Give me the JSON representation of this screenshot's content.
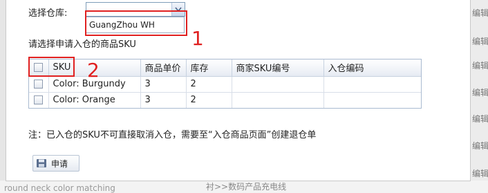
{
  "background": {
    "right_edit_labels": [
      "编辑",
      "编辑",
      "编辑",
      "编辑",
      "编辑",
      "编辑",
      "编辑"
    ],
    "bottom_left_text": "round neck color matching",
    "bottom_mid_text": "衬>>数码产品充电线"
  },
  "warehouse": {
    "label": "选择仓库:",
    "selected_value": "",
    "options": [
      "GuangZhou WH"
    ]
  },
  "annotations": {
    "mark_1": "1",
    "mark_2": "2"
  },
  "prompt": "请选择申请入仓的商品SKU",
  "table": {
    "headers": [
      "SKU",
      "商品单价",
      "库存",
      "商家SKU编号",
      "入仓编码"
    ],
    "rows": [
      {
        "sku": "Color: Burgundy",
        "price": "3",
        "stock": "2",
        "merchant_sku": "",
        "inbound_code": ""
      },
      {
        "sku": "Color: Orange",
        "price": "3",
        "stock": "2",
        "merchant_sku": "",
        "inbound_code": ""
      }
    ]
  },
  "note": "注：已入仓的SKU不可直接取消入仓，需要至“入仓商品页面”创建退仓单",
  "apply_button": {
    "label": "申请",
    "icon": "floppy-disk-icon"
  },
  "colors": {
    "annotation": "#e02020",
    "accent": "#7f9db9"
  }
}
